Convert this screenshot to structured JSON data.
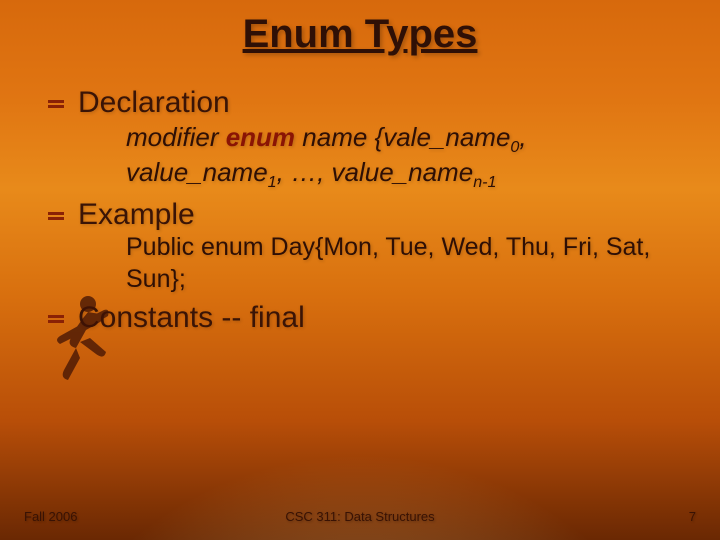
{
  "title": "Enum Types",
  "items": {
    "declaration": {
      "label": "Declaration",
      "syntax_pre": "modifier ",
      "syntax_kw": "enum",
      "syntax_post1": " name {vale_name",
      "syntax_sub0": "0",
      "syntax_post2": ", value_name",
      "syntax_sub1": "1",
      "syntax_post3": ", …, value_name",
      "syntax_subn": "n-1"
    },
    "example": {
      "label": "Example",
      "code": "Public enum Day{Mon, Tue, Wed, Thu, Fri, Sat, Sun};"
    },
    "constants": {
      "label": "Constants -- final"
    }
  },
  "footer": {
    "left": "Fall 2006",
    "center": "CSC 311: Data Structures",
    "right": "7"
  }
}
